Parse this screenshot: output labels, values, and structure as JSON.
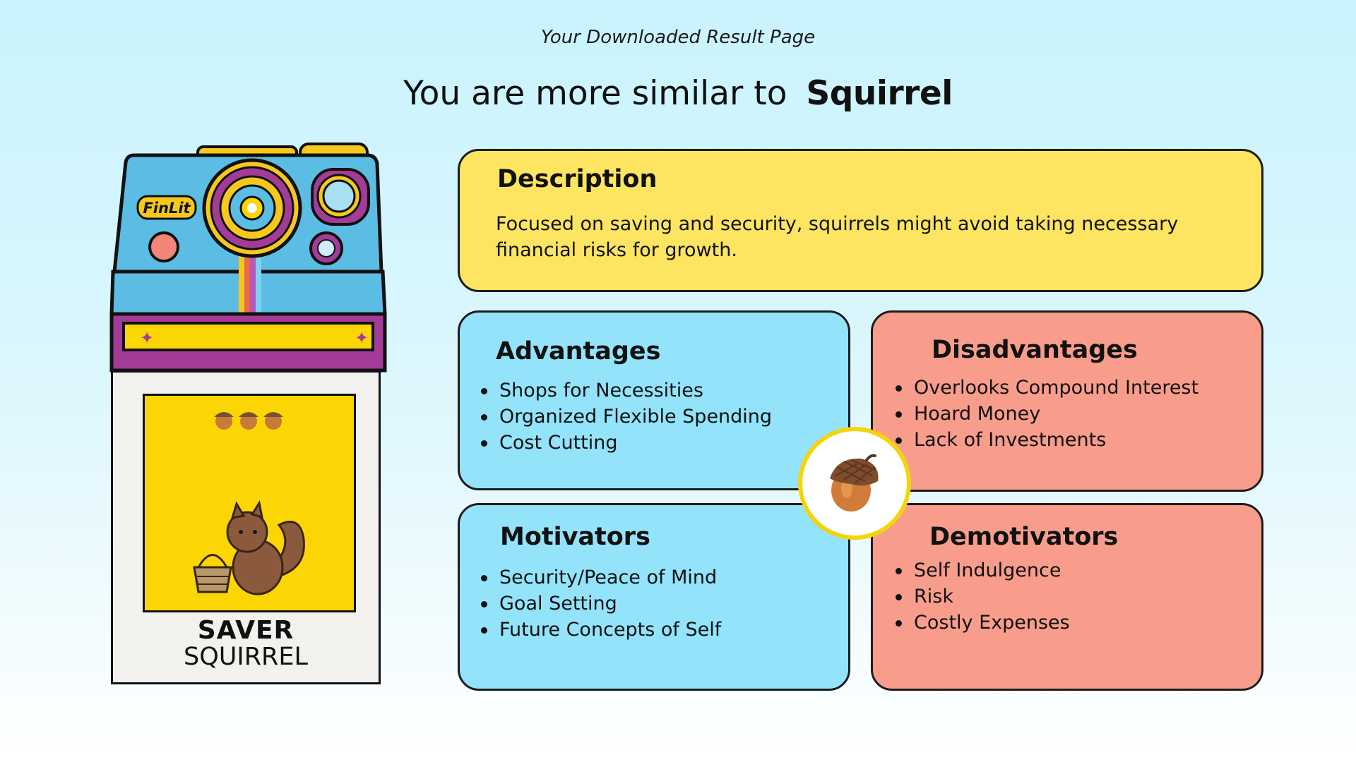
{
  "page": {
    "subtitle": "Your Downloaded Result Page",
    "headline_prefix": "You are more similar to",
    "headline_animal": "Squirrel"
  },
  "camera": {
    "brand": "FinLit",
    "caption_bold": "SAVER",
    "caption": "SQUIRREL",
    "icons": [
      "camera-icon",
      "squirrel-icon",
      "acorn-icon"
    ]
  },
  "cards": {
    "description": {
      "title": "Description",
      "text": "Focused on saving and security, squirrels might avoid taking necessary financial risks for growth."
    },
    "advantages": {
      "title": "Advantages",
      "items": [
        "Shops for Necessities",
        "Organized Flexible Spending",
        "Cost Cutting"
      ]
    },
    "disadvantages": {
      "title": "Disadvantages",
      "items": [
        "Overlooks Compound Interest",
        "Hoard Money",
        "Lack of Investments"
      ]
    },
    "motivators": {
      "title": "Motivators",
      "items": [
        "Security/Peace of Mind",
        "Goal Setting",
        "Future Concepts of Self"
      ]
    },
    "demotivators": {
      "title": "Demotivators",
      "items": [
        "Self Indulgence",
        "Risk",
        "Costly Expenses"
      ]
    }
  },
  "colors": {
    "description": "#fde561",
    "positive": "#93e3fa",
    "negative": "#f89d8c",
    "badge_ring": "#f5d40a"
  }
}
